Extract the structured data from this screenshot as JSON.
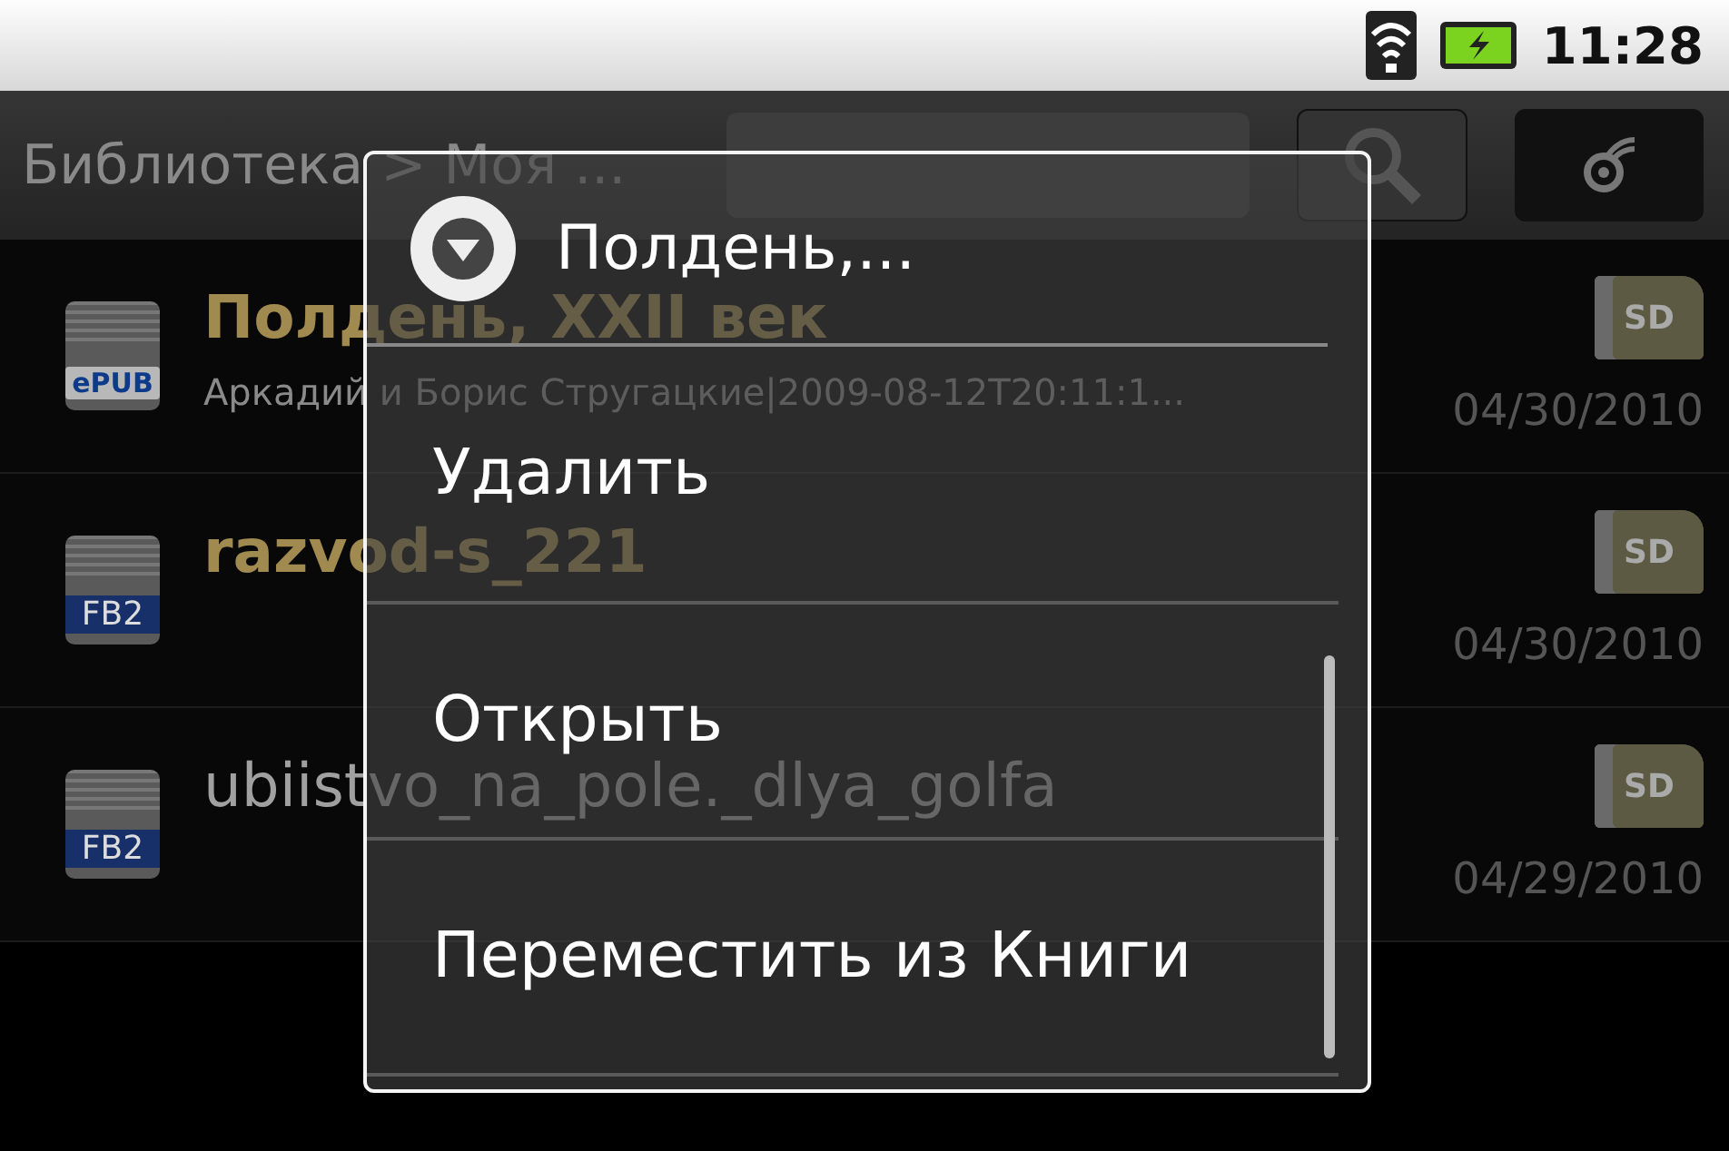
{
  "status_bar": {
    "time": "11:28"
  },
  "title_bar": {
    "breadcrumb": "Библиотека > Моя ..."
  },
  "books": [
    {
      "title": "Полдень, XXII век",
      "emphasized": true,
      "format": "ePUB",
      "subtitle": "Аркадий и Борис Стругацкие|2009-08-12T20:11:1...",
      "storage": "SD",
      "date": "04/30/2010"
    },
    {
      "title": "razvod-s_221",
      "emphasized": true,
      "format": "FB2",
      "storage": "SD",
      "date": "04/30/2010"
    },
    {
      "title": "ubiistvo_na_pole._dlya_golfa",
      "emphasized": false,
      "format": "FB2",
      "storage": "SD",
      "date": "04/29/2010"
    }
  ],
  "context_menu": {
    "title": "Полдень,...",
    "items": [
      {
        "label": "Удалить"
      },
      {
        "label": "Открыть"
      },
      {
        "label": "Переместить из Книги"
      }
    ]
  }
}
